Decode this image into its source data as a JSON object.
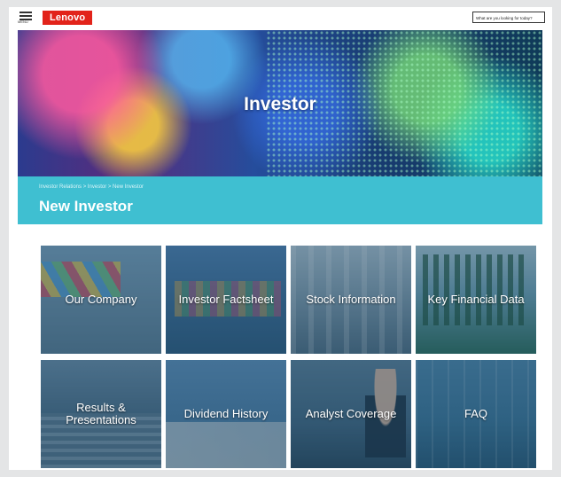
{
  "header": {
    "menu_label": "MENU",
    "logo": "Lenovo",
    "search_placeholder": "What are you looking for today?"
  },
  "hero": {
    "title": "Investor"
  },
  "band": {
    "breadcrumb": "Investor Relations > Investor > New Investor",
    "title": "New Investor"
  },
  "tiles": [
    {
      "label": "Our Company"
    },
    {
      "label": "Investor Factsheet"
    },
    {
      "label": "Stock Information"
    },
    {
      "label": "Key Financial Data"
    },
    {
      "label": "Results & Presentations"
    },
    {
      "label": "Dividend History"
    },
    {
      "label": "Analyst Coverage"
    },
    {
      "label": "FAQ"
    }
  ],
  "colors": {
    "brand": "#e2231a",
    "accent": "#3fbfd1"
  },
  "icons": {
    "menu": "hamburger-menu-icon",
    "search": "search-icon"
  }
}
